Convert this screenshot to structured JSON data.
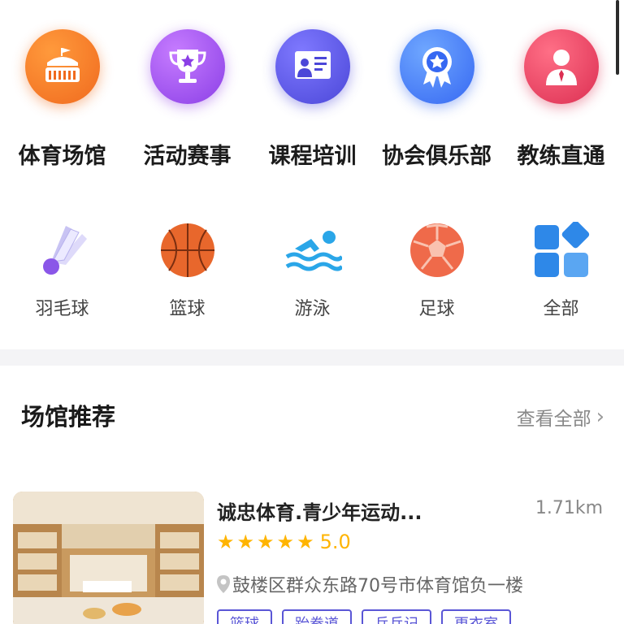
{
  "categories": [
    {
      "label": "体育场馆",
      "icon": "stadium-icon",
      "color": "#f06a1e"
    },
    {
      "label": "活动赛事",
      "icon": "trophy-icon",
      "color": "#8b3fe6"
    },
    {
      "label": "课程培训",
      "icon": "presentation-board-icon",
      "color": "#4b47d8"
    },
    {
      "label": "协会俱乐部",
      "icon": "award-badge-icon",
      "color": "#3668f2"
    },
    {
      "label": "教练直通",
      "icon": "coach-person-icon",
      "color": "#dc2f52"
    }
  ],
  "sports": [
    {
      "label": "羽毛球",
      "icon": "shuttlecock-icon"
    },
    {
      "label": "篮球",
      "icon": "basketball-icon"
    },
    {
      "label": "游泳",
      "icon": "swimmer-icon"
    },
    {
      "label": "足球",
      "icon": "soccer-ball-icon"
    },
    {
      "label": "全部",
      "icon": "all-grid-icon"
    }
  ],
  "section": {
    "title": "场馆推荐",
    "more_label": "查看全部"
  },
  "venue": {
    "name": "诚忠体育.青少年运动...",
    "distance": "1.71km",
    "rating": "5.0",
    "stars": 5,
    "address": "鼓楼区群众东路70号市体育馆负一楼",
    "tags": [
      "篮球",
      "跆拳道",
      "乒乓记",
      "更衣室"
    ]
  }
}
